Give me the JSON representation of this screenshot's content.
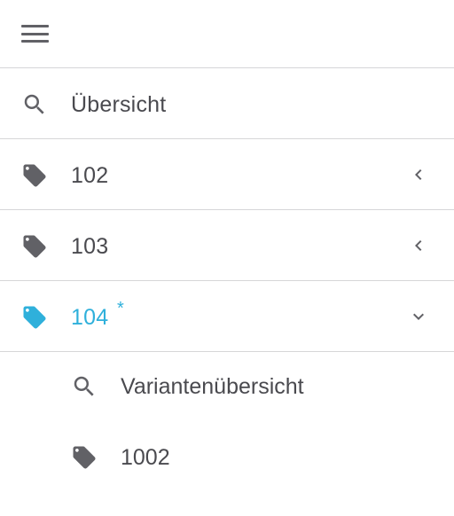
{
  "colors": {
    "text": "#4a4a4f",
    "icon": "#616166",
    "accent": "#2fb0db",
    "divider": "#d6d6d8"
  },
  "header": {
    "menu_icon": "hamburger-menu-icon"
  },
  "nav": {
    "items": [
      {
        "label": "Übersicht",
        "icon": "search-icon"
      },
      {
        "label": "102",
        "icon": "tag-icon",
        "chevron": "chevron-left-icon"
      },
      {
        "label": "103",
        "icon": "tag-icon",
        "chevron": "chevron-left-icon"
      },
      {
        "label": "104",
        "icon": "tag-icon",
        "chevron": "chevron-down-icon",
        "active": true,
        "marker": "*"
      }
    ],
    "subitems": [
      {
        "label": "Variantenübersicht",
        "icon": "search-icon"
      },
      {
        "label": "1002",
        "icon": "tag-icon"
      }
    ]
  }
}
